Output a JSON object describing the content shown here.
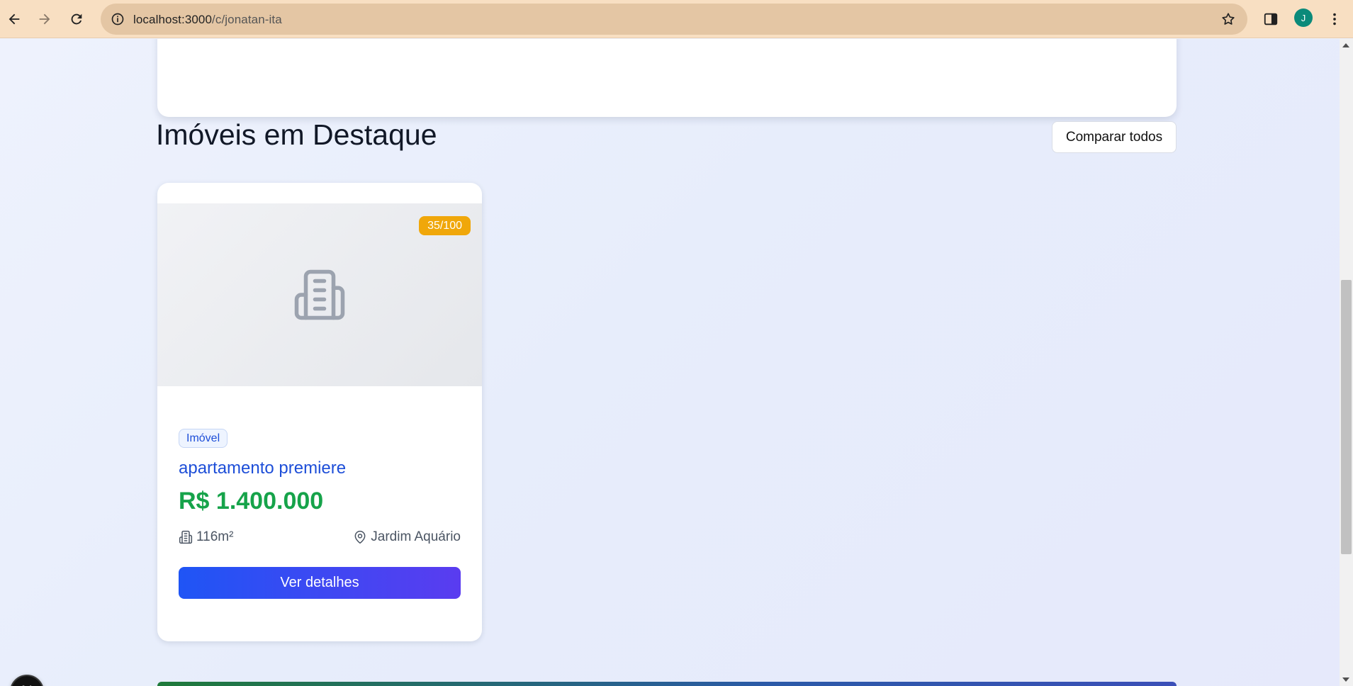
{
  "browser": {
    "url_host": "localhost:3000",
    "url_path": "/c/jonatan-ita",
    "profile_initial": "J"
  },
  "section": {
    "title": "Imóveis em Destaque",
    "compare_label": "Comparar todos"
  },
  "property_card": {
    "score": "35/100",
    "type_label": "Imóvel",
    "title": "apartamento premiere",
    "price": "R$ 1.400.000",
    "area": "116m²",
    "location": "Jardim Aquário",
    "details_label": "Ver detalhes"
  },
  "dev_badge": {
    "letter": "N"
  },
  "colors": {
    "chrome_bg": "#f8dfc2",
    "omnibox_bg": "#e4c6a4",
    "title_blue": "#1d4ed8",
    "price_green": "#16a34a",
    "score_orange": "#f0a70a",
    "button_gradient_start": "#1f55f5",
    "button_gradient_end": "#5a3cf0"
  },
  "icons": {
    "back": "arrow-left-icon",
    "forward": "arrow-right-icon",
    "reload": "reload-icon",
    "site_info": "info-icon",
    "bookmark": "star-icon",
    "side_panel": "side-panel-icon",
    "menu": "kebab-menu-icon",
    "placeholder": "building-icon",
    "area": "building-small-icon",
    "location": "map-pin-icon"
  }
}
